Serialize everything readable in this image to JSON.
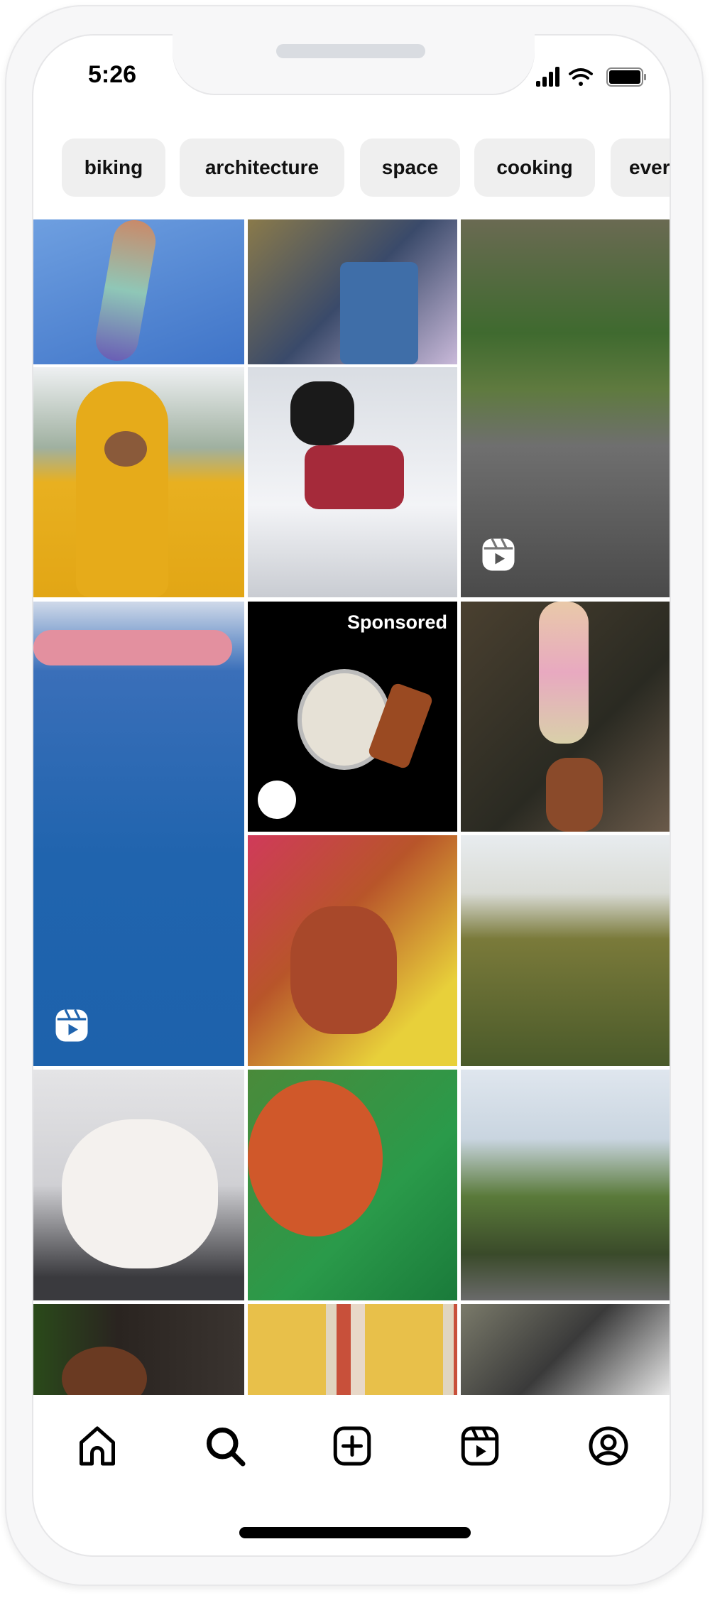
{
  "status_bar": {
    "time": "5:26",
    "icons": [
      "signal-icon",
      "wifi-icon",
      "battery-icon"
    ]
  },
  "chips": [
    {
      "label": "biking"
    },
    {
      "label": "architecture"
    },
    {
      "label": "space"
    },
    {
      "label": "cooking"
    },
    {
      "label": "ever"
    }
  ],
  "grid": {
    "tiles": [
      {
        "name": "raised-hand-sky",
        "type": "image"
      },
      {
        "name": "friends-lying-grass",
        "type": "image"
      },
      {
        "name": "forest-road",
        "type": "reel"
      },
      {
        "name": "yellow-raincoat-person",
        "type": "image"
      },
      {
        "name": "dog-in-snow",
        "type": "image"
      },
      {
        "name": "underwater-flamingo",
        "type": "reel"
      },
      {
        "name": "watch-ad",
        "type": "sponsored"
      },
      {
        "name": "ice-cream-cone",
        "type": "image"
      },
      {
        "name": "peace-sign-friends",
        "type": "image"
      },
      {
        "name": "sunflower-field",
        "type": "image"
      },
      {
        "name": "white-puppy",
        "type": "image"
      },
      {
        "name": "basketball-hands",
        "type": "image"
      },
      {
        "name": "garden-patio",
        "type": "image"
      },
      {
        "name": "person-curly-hair",
        "type": "image"
      },
      {
        "name": "striped-awning",
        "type": "image"
      }
    ],
    "sponsored_label": "Sponsored"
  },
  "bottom_nav": {
    "items": [
      {
        "name": "home",
        "icon": "home-icon"
      },
      {
        "name": "search",
        "icon": "search-icon",
        "active": true
      },
      {
        "name": "create",
        "icon": "plus-square-icon"
      },
      {
        "name": "reels",
        "icon": "reels-icon"
      },
      {
        "name": "profile",
        "icon": "profile-icon"
      }
    ]
  }
}
